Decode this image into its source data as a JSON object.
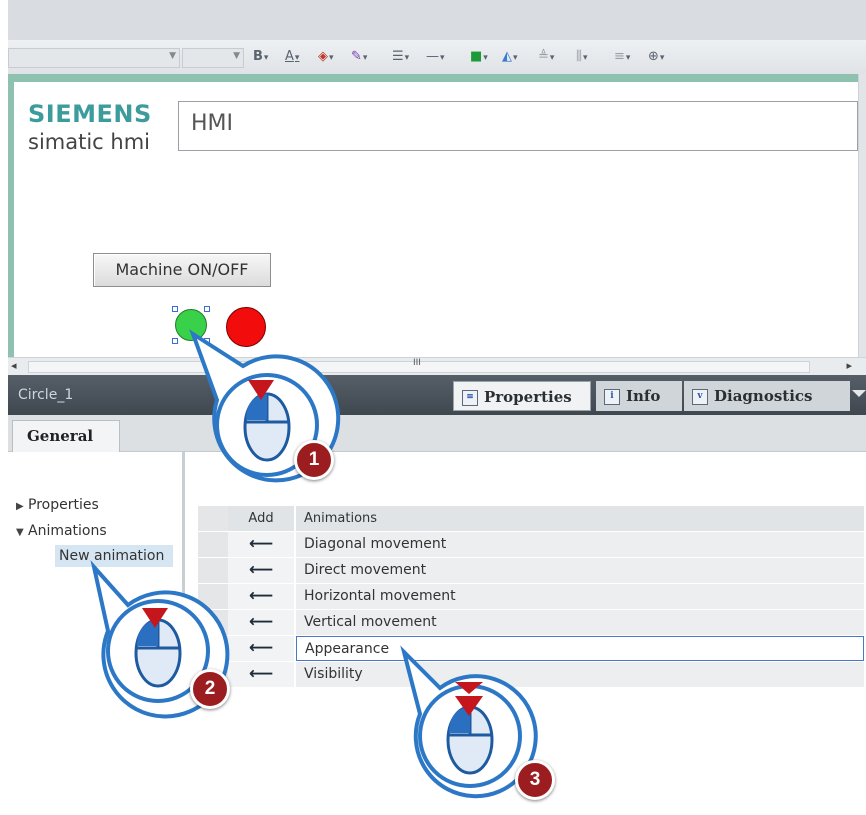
{
  "screen": {
    "header_text": "HMI",
    "logo_brand": "SIEMENS",
    "logo_sub": "simatic hmi",
    "button_label": "Machine ON/OFF"
  },
  "toolbar": {
    "items": [
      {
        "icon": "bold-icon",
        "label": "B"
      },
      {
        "icon": "font-color-icon",
        "label": "A"
      },
      {
        "icon": "fill-color-icon"
      },
      {
        "icon": "line-color-icon"
      },
      {
        "icon": "align-icon"
      },
      {
        "icon": "line-style-icon"
      },
      {
        "icon": "object-color-icon"
      },
      {
        "icon": "shape-icon"
      },
      {
        "icon": "align-objects-icon"
      },
      {
        "icon": "distribute-icon"
      },
      {
        "icon": "spacing-icon"
      },
      {
        "icon": "zoom-icon"
      }
    ]
  },
  "inspector": {
    "object_name": "Circle_1",
    "tabs": {
      "properties": "Properties",
      "info": "Info",
      "diagnostics": "Diagnostics"
    },
    "general_tab": "General",
    "nav": {
      "properties": "Properties",
      "animations": "Animations",
      "new_animation": "New animation"
    },
    "table": {
      "col_add": "Add",
      "col_animations": "Animations",
      "rows": [
        "Diagonal movement",
        "Direct movement",
        "Horizontal movement",
        "Vertical movement",
        "Appearance",
        "Visibility"
      ],
      "selected_row": "Appearance"
    }
  },
  "hscroll": {
    "grip": "III"
  },
  "steps": [
    "1",
    "2",
    "3"
  ],
  "colors": {
    "accent_border": "#8fc1b1",
    "siemens_teal": "#3c9b9b",
    "circle_green": "#3ad14a",
    "circle_red": "#f20c0c",
    "step_badge": "#9c1d1f",
    "callout_blue": "#2c78c6"
  }
}
